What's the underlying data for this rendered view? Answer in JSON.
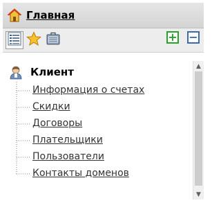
{
  "header": {
    "title": "Главная",
    "icon": "home-icon"
  },
  "toolbar": {
    "buttons": [
      {
        "icon": "list-icon",
        "active": true
      },
      {
        "icon": "star-icon",
        "active": false
      },
      {
        "icon": "briefcase-icon",
        "active": false
      }
    ],
    "expand_icon": "plus-square-icon",
    "collapse_icon": "minus-square-icon"
  },
  "tree": {
    "root": {
      "label": "Клиент",
      "icon": "user-icon"
    },
    "items": [
      {
        "label": "Информация о счетах"
      },
      {
        "label": "Скидки"
      },
      {
        "label": "Договоры"
      },
      {
        "label": "Плательщики"
      },
      {
        "label": "Пользователи"
      },
      {
        "label": "Контакты доменов"
      }
    ]
  },
  "colors": {
    "expand": "#27a327",
    "collapse": "#3d6aa8",
    "header_bg": "#dcdcdc"
  }
}
